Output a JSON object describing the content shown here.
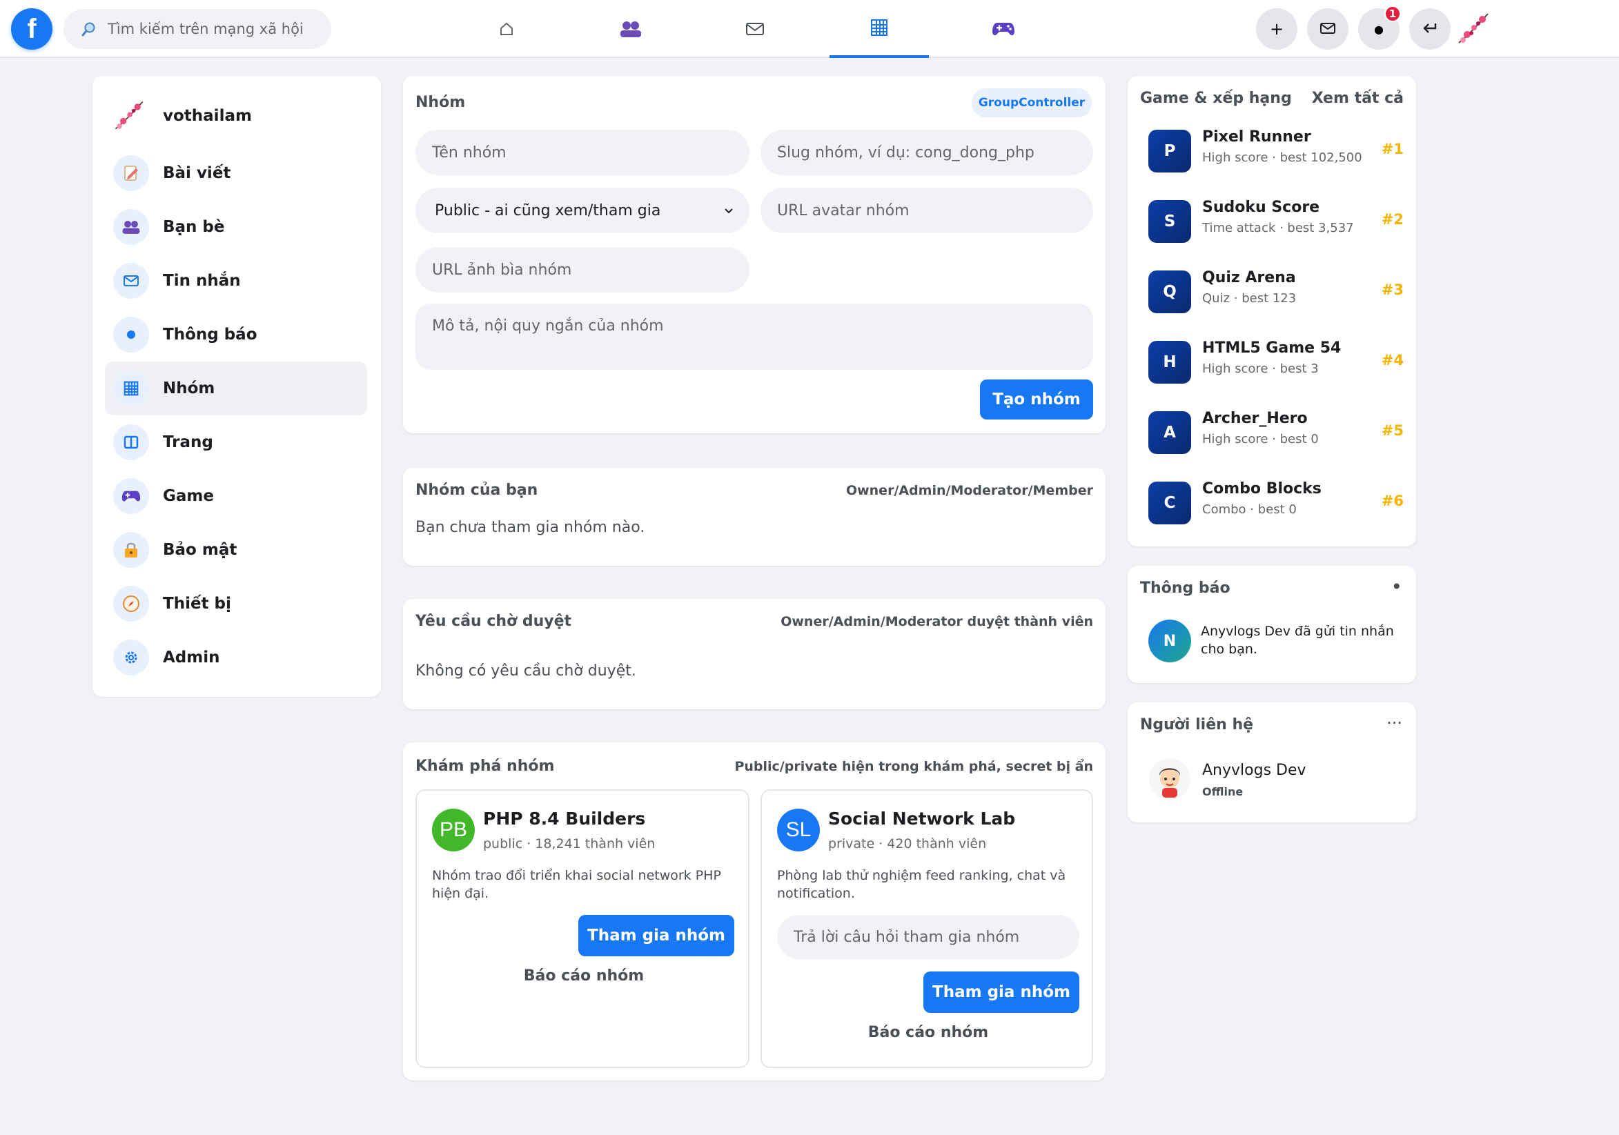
{
  "topbar": {
    "logo": "f",
    "search_placeholder": "Tìm kiếm trên mạng xã hội",
    "nav_tabs": [
      "home-icon",
      "friends-icon",
      "mail-icon",
      "grid-icon",
      "game-icon"
    ],
    "active_tab": "grid-icon",
    "actions": {
      "plus": "+",
      "dot": "●",
      "notif_count": "1"
    }
  },
  "sidebar": {
    "username": "vothailam",
    "items": [
      {
        "label": "Bài viết",
        "icon": "pencil-icon"
      },
      {
        "label": "Bạn bè",
        "icon": "friends-icon"
      },
      {
        "label": "Tin nhắn",
        "icon": "mail-icon"
      },
      {
        "label": "Thông báo",
        "icon": "dot-icon"
      },
      {
        "label": "Nhóm",
        "icon": "grid-icon"
      },
      {
        "label": "Trang",
        "icon": "page-icon"
      },
      {
        "label": "Game",
        "icon": "gamepad-icon"
      },
      {
        "label": "Bảo mật",
        "icon": "lock-icon"
      },
      {
        "label": "Thiết bị",
        "icon": "compass-icon"
      },
      {
        "label": "Admin",
        "icon": "gear-icon"
      }
    ],
    "active": "Nhóm"
  },
  "create_group": {
    "title": "Nhóm",
    "badge": "GroupController",
    "name_placeholder": "Tên nhóm",
    "slug_placeholder": "Slug nhóm, ví dụ: cong_dong_php",
    "privacy_value": "Public - ai cũng xem/tham gia",
    "avatar_placeholder": "URL avatar nhóm",
    "cover_placeholder": "URL ảnh bìa nhóm",
    "desc_placeholder": "Mô tả, nội quy ngắn của nhóm",
    "submit": "Tạo nhóm"
  },
  "my_groups": {
    "title": "Nhóm của bạn",
    "subtitle": "Owner/Admin/Moderator/Member",
    "empty": "Bạn chưa tham gia nhóm nào."
  },
  "pending": {
    "title": "Yêu cầu chờ duyệt",
    "subtitle": "Owner/Admin/Moderator duyệt thành viên",
    "empty": "Không có yêu cầu chờ duyệt."
  },
  "explore": {
    "title": "Khám phá nhóm",
    "subtitle": "Public/private hiện trong khám phá, secret bị ẩn",
    "groups": [
      {
        "initials": "PB",
        "name": "PHP 8.4 Builders",
        "meta": "public · 18,241 thành viên",
        "desc": "Nhóm trao đổi triển khai social network PHP hiện đại.",
        "join": "Tham gia nhóm",
        "report": "Báo cáo nhóm",
        "color": "#42b72a"
      },
      {
        "initials": "SL",
        "name": "Social Network Lab",
        "meta": "private · 420 thành viên",
        "desc": "Phòng lab thử nghiệm feed ranking, chat và notification.",
        "answer_placeholder": "Trả lời câu hỏi tham gia nhóm",
        "join": "Tham gia nhóm",
        "report": "Báo cáo nhóm",
        "color": "#1877f2"
      }
    ]
  },
  "games": {
    "title": "Game & xếp hạng",
    "see_all": "Xem tất cả",
    "items": [
      {
        "letter": "P",
        "name": "Pixel Runner",
        "meta": "High score · best 102,500",
        "rank": "#1"
      },
      {
        "letter": "S",
        "name": "Sudoku Score",
        "meta": "Time attack · best 3,537",
        "rank": "#2"
      },
      {
        "letter": "Q",
        "name": "Quiz Arena",
        "meta": "Quiz · best 123",
        "rank": "#3"
      },
      {
        "letter": "H",
        "name": "HTML5 Game 54",
        "meta": "High score · best 3",
        "rank": "#4"
      },
      {
        "letter": "A",
        "name": "Archer_Hero",
        "meta": "High score · best 0",
        "rank": "#5"
      },
      {
        "letter": "C",
        "name": "Combo Blocks",
        "meta": "Combo · best 0",
        "rank": "#6"
      }
    ]
  },
  "notifications": {
    "title": "Thông báo",
    "dot": "•",
    "items": [
      {
        "initial": "N",
        "text": "Anyvlogs Dev đã gửi tin nhắn cho bạn."
      }
    ]
  },
  "contacts": {
    "title": "Người liên hệ",
    "more": "···",
    "items": [
      {
        "name": "Anyvlogs Dev",
        "status": "Offline"
      }
    ]
  },
  "colors": {
    "accent": "#1877f2",
    "rank": "#f5b400",
    "badge": "#e41e3f"
  }
}
